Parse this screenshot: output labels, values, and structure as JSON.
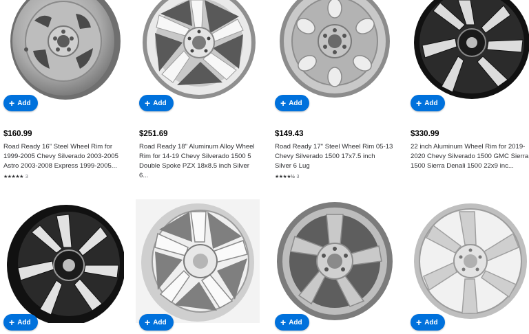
{
  "add_label": "Add",
  "add_icon": "plus-icon",
  "products": [
    {
      "price": "$160.99",
      "title": "Road Ready 16\" Steel Wheel Rim for 1999-2005 Chevy Silverado 2003-2005 Astro 2003-2008 Express 1999-2005...",
      "stars": "★★★★★",
      "review_count": "3"
    },
    {
      "price": "$251.69",
      "title": "Road Ready 18\" Aluminum Alloy Wheel Rim for 14-19 Chevy Silverado 1500 5 Double Spoke PZX 18x8.5 inch Silver 6...",
      "stars": "",
      "review_count": ""
    },
    {
      "price": "$149.43",
      "title": "Road Ready 17\" Steel Wheel Rim 05-13 Chevy Silverado 1500 17x7.5 inch Silver 6 Lug",
      "stars": "★★★★½",
      "review_count": "3"
    },
    {
      "price": "$330.99",
      "title": "22 inch Aluminum Wheel Rim for 2019-2020 Chevy Silverado 1500 GMC Sierra 1500 Sierra Denali 1500 22x9 inc...",
      "stars": "",
      "review_count": ""
    },
    {
      "price": "",
      "title": "",
      "stars": "",
      "review_count": ""
    },
    {
      "price": "",
      "title": "",
      "stars": "",
      "review_count": ""
    },
    {
      "price": "",
      "title": "",
      "stars": "",
      "review_count": ""
    },
    {
      "price": "",
      "title": "",
      "stars": "",
      "review_count": ""
    }
  ]
}
